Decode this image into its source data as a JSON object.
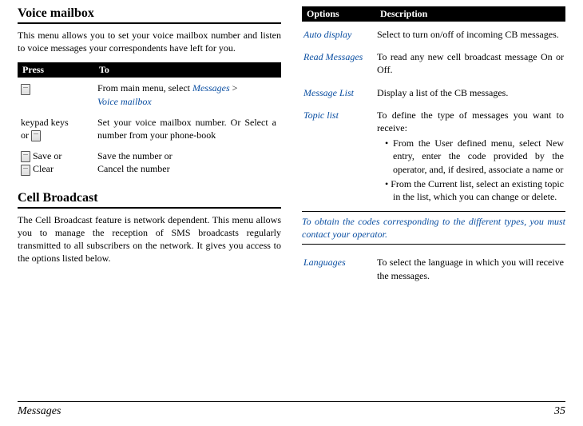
{
  "left": {
    "h_voice": "Voice mailbox",
    "voice_para": "This menu allows you to set your voice mailbox number and listen to voice messages your correspondents have left for you.",
    "press_head1": "Press",
    "press_head2": "To",
    "row1_c1_suffix": "",
    "row1_text_a": "From main menu, select ",
    "row1_link1": "Messages",
    "row1_gt": " > ",
    "row1_link2": "Voice mailbox",
    "row2_c1a": " keypad keys",
    "row2_c1b": " or ",
    "row2_text": "Set your voice mailbox number. Or Select a number from your phone-book",
    "row3_c1a": " Save or",
    "row3_c1b": " Clear",
    "row3_text_a": "Save the number or",
    "row3_text_b": "Cancel the number",
    "h_cell": "Cell Broadcast",
    "cell_para": "The Cell Broadcast feature is network dependent. This menu allows you to manage the reception of SMS broadcasts regularly transmitted to all subscribers on the network. It gives you access to the options listed below."
  },
  "right": {
    "head1": "Options",
    "head2": "Description",
    "auto_label": "Auto display",
    "auto_desc": "Select to turn on/off of incoming CB messages.",
    "read_label": "Read Messages",
    "read_desc": "To read any new cell broadcast message On or Off.",
    "msglist_label": "Message List",
    "msglist_desc": "Display a list of the CB messages.",
    "topic_label": "Topic list",
    "topic_desc": "To define the type of messages you want to receive:",
    "topic_b1": "From the User defined menu, select New entry, enter the code provided by the operator, and, if desired, associate a name or",
    "topic_b2": "From the Current list, select an existing topic in the list, which you can change or delete.",
    "note": "To obtain the codes corresponding to the different types, you must contact your operator.",
    "lang_label": "Languages",
    "lang_desc": "To select the language in which you will receive the messages."
  },
  "footer": {
    "section": "Messages",
    "page": "35"
  }
}
